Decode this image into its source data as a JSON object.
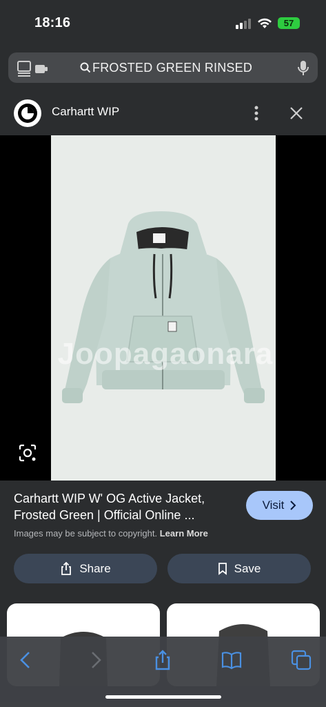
{
  "status_bar": {
    "time": "18:16",
    "battery": "57"
  },
  "address_bar": {
    "query": "FROSTED GREEN RINSED"
  },
  "header": {
    "site_name": "Carhartt WIP"
  },
  "image": {
    "watermark": "Joopagaonara"
  },
  "result": {
    "title": "Carhartt WIP W' OG Active Jacket, Frosted Green | Official Online ...",
    "visit_label": "Visit",
    "copyright_text": "Images may be subject to copyright.",
    "learn_more_label": "Learn More",
    "share_label": "Share",
    "save_label": "Save"
  },
  "colors": {
    "background": "#2b2d2f",
    "visit_button": "#a8c7fa",
    "action_button": "#3b4656",
    "battery": "#2ecc40",
    "toolbar_icon": "#4a90e2",
    "jacket": "#c5d6d0"
  },
  "icons": {
    "tabs": "tabs-icon",
    "search": "search-icon",
    "mic": "mic-icon",
    "more": "more-vert-icon",
    "close": "close-icon",
    "lens": "lens-icon",
    "share": "share-icon",
    "save": "bookmark-icon",
    "back": "back-icon",
    "forward": "forward-icon",
    "bookmarks": "book-icon",
    "tab_switcher": "tab-switcher-icon"
  }
}
